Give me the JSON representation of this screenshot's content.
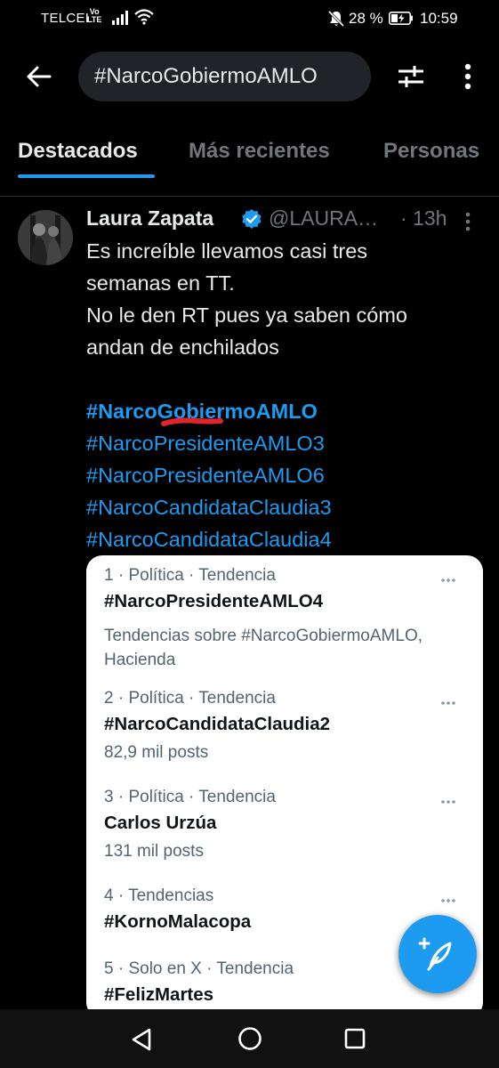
{
  "status_bar": {
    "carrier": "TELCEL",
    "volte_top": "Vo",
    "volte_bottom": "LTE",
    "battery_percent": "28 %",
    "time": "10:59",
    "icons": [
      "signal-icon",
      "wifi-icon",
      "mute-icon",
      "battery-icon"
    ]
  },
  "search": {
    "query": "#NarcoGobiermoAMLO",
    "icons": [
      "back-arrow-icon",
      "filter-sliders-icon",
      "more-vertical-icon"
    ]
  },
  "tabs": [
    {
      "label": "Destacados",
      "active": true
    },
    {
      "label": "Más recientes",
      "active": false
    },
    {
      "label": "Personas",
      "active": false
    }
  ],
  "tweet": {
    "author": "Laura Zapata",
    "handle": "@LAURA…",
    "time": "· 13h",
    "verified": true,
    "lines": [
      "Es increíble llevamos casi tres",
      "semanas en TT.",
      "No le den RT pues ya saben cómo",
      "andan de enchilados"
    ],
    "hashtags": [
      "#NarcoGobiermoAMLO",
      "#NarcoPresidenteAMLO3",
      "#NarcoPresidenteAMLO6",
      "#NarcoCandidataClaudia3",
      "#NarcoCandidataClaudia4"
    ]
  },
  "trends": [
    {
      "meta": "1 · Política · Tendencia",
      "title": "#NarcoPresidenteAMLO4",
      "sub": "Tendencias sobre #NarcoGobiermoAMLO, Hacienda"
    },
    {
      "meta": "2 · Política · Tendencia",
      "title": "#NarcoCandidataClaudia2",
      "sub": "82,9 mil posts"
    },
    {
      "meta": "3 · Política · Tendencia",
      "title": "Carlos Urzúa",
      "sub": "131 mil posts"
    },
    {
      "meta": "4 · Tendencias",
      "title": "#KornoMalacopa",
      "sub": ""
    },
    {
      "meta": "5 · Solo en X · Tendencia",
      "title": "#FelizMartes",
      "sub": ""
    }
  ],
  "colors": {
    "background": "#000000",
    "accent": "#1d9bf0",
    "muted_text": "#71767b",
    "card_background": "#ffffff"
  }
}
